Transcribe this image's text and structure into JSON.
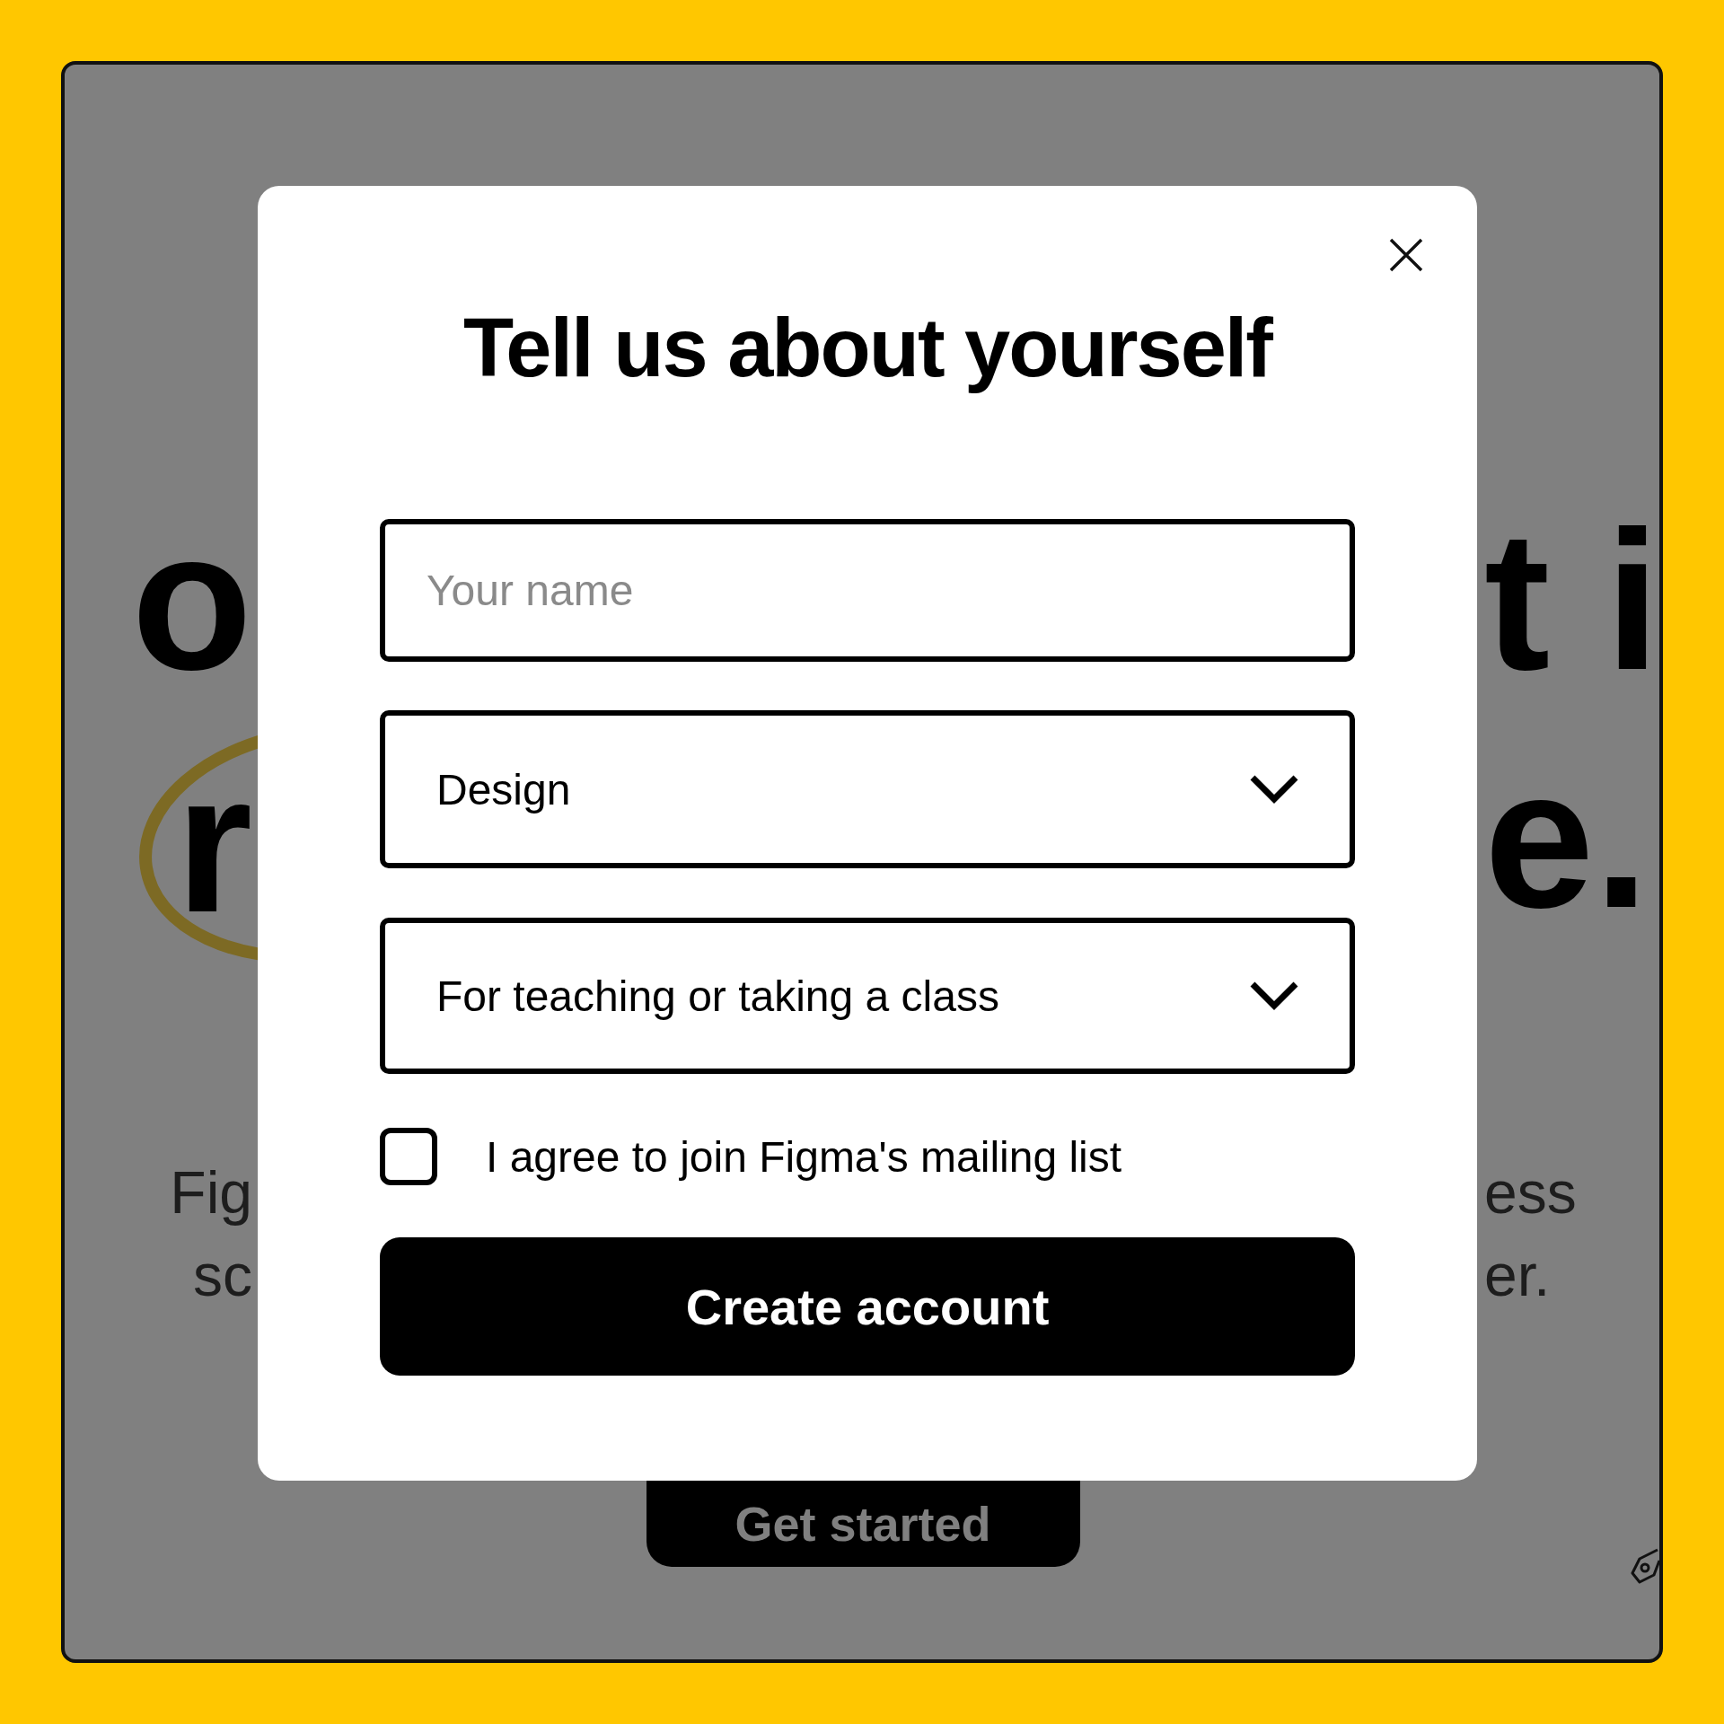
{
  "background_page": {
    "headline_lines": [
      {
        "left": "o",
        "right": "t i"
      },
      {
        "left": "r",
        "right": "e."
      }
    ],
    "body_lines": [
      {
        "left": "Fig",
        "right": "ess"
      },
      {
        "left": "sc",
        "right": "er."
      }
    ],
    "button": "Get started"
  },
  "dialog": {
    "title": "Tell us about yourself",
    "name_field": {
      "placeholder": "Your name"
    },
    "dropdowns": [
      {
        "value": "Design"
      },
      {
        "value": "For teaching or taking a class"
      }
    ],
    "checkbox": {
      "label": "I agree to join Figma's mailing list",
      "checked": false
    },
    "submit_button": "Create account"
  }
}
